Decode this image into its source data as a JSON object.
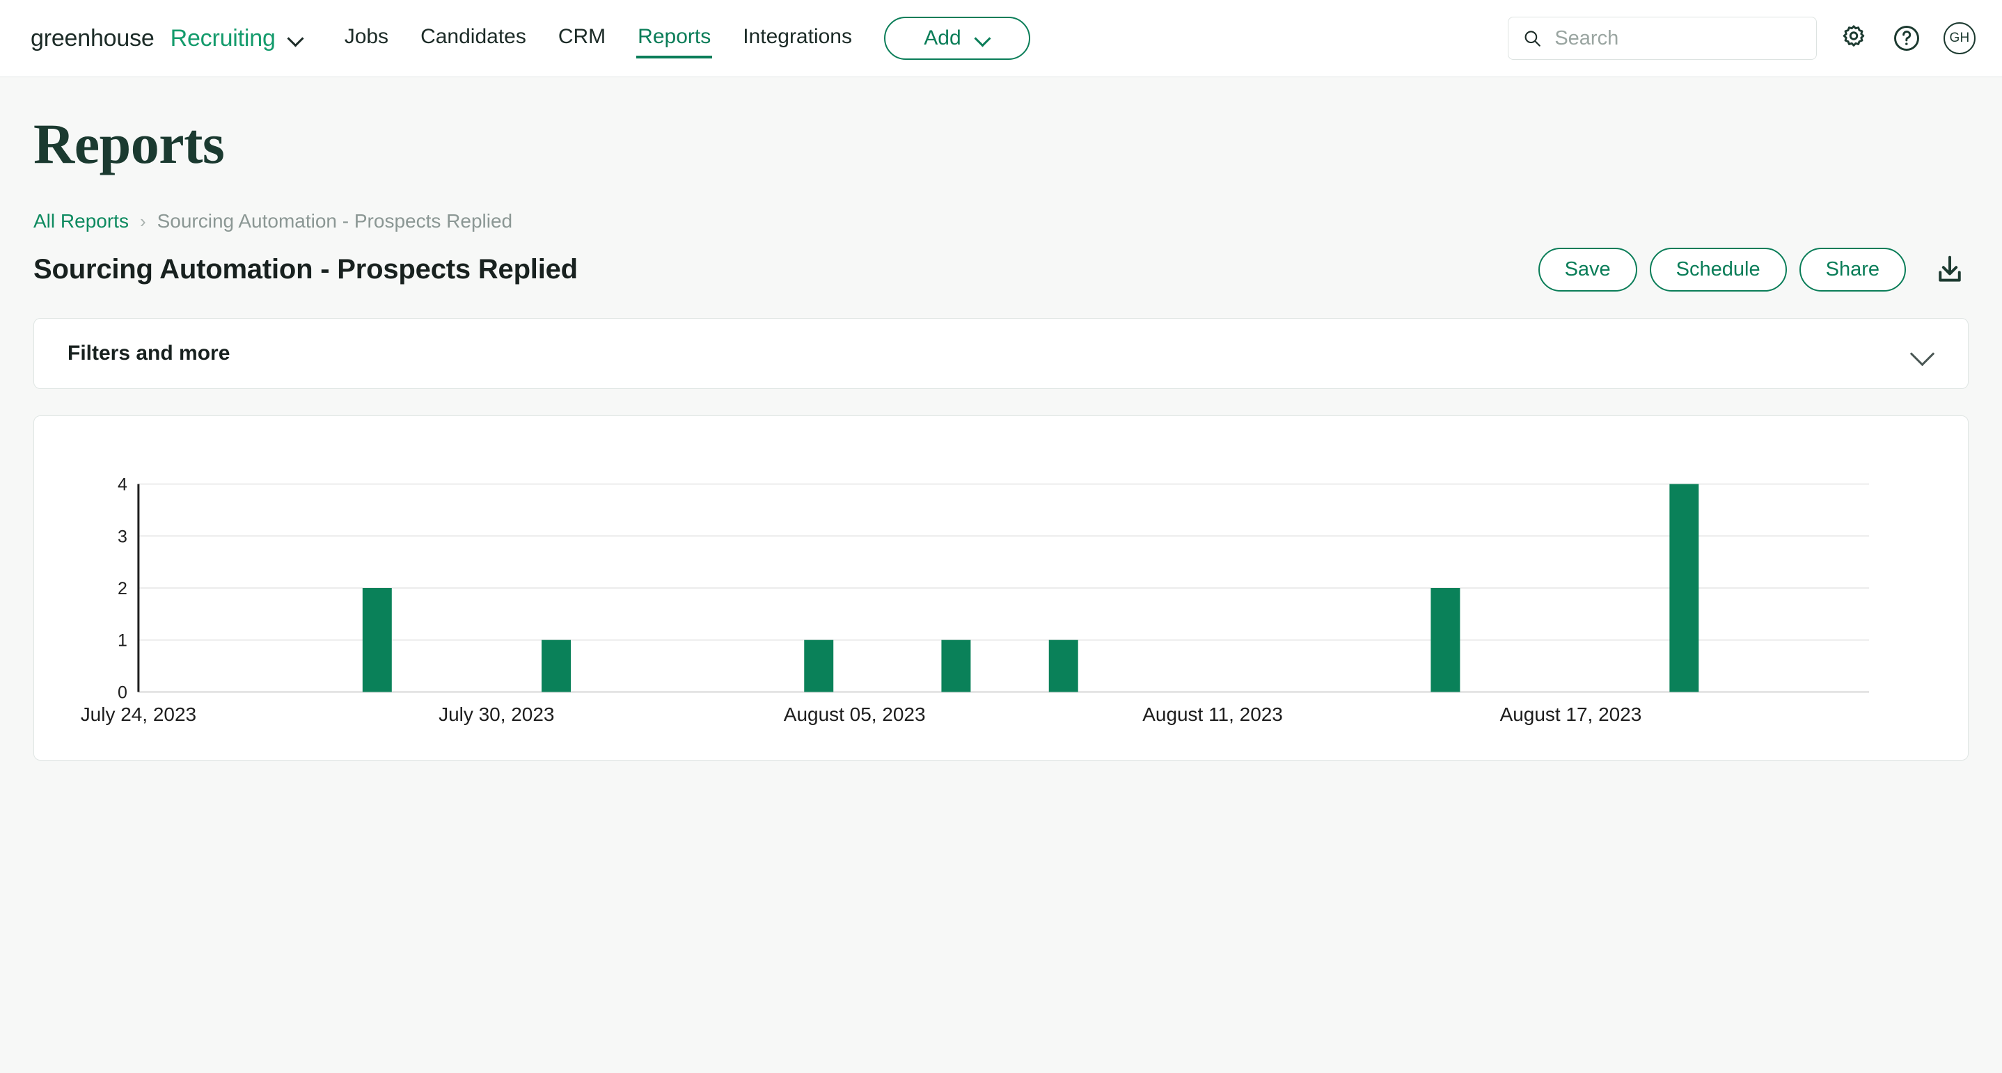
{
  "nav": {
    "brand_primary": "greenhouse",
    "brand_secondary": "Recruiting",
    "items": [
      {
        "label": "Jobs",
        "active": false
      },
      {
        "label": "Candidates",
        "active": false
      },
      {
        "label": "CRM",
        "active": false
      },
      {
        "label": "Reports",
        "active": true
      },
      {
        "label": "Integrations",
        "active": false
      }
    ],
    "add_label": "Add",
    "search_placeholder": "Search",
    "search_value": "",
    "avatar_initials": "GH"
  },
  "page": {
    "title": "Reports",
    "breadcrumb": {
      "root": "All Reports",
      "separator": "›",
      "current": "Sourcing Automation - Prospects Replied"
    },
    "report_title": "Sourcing Automation - Prospects Replied",
    "actions": {
      "save": "Save",
      "schedule": "Schedule",
      "share": "Share"
    },
    "filters_label": "Filters and more"
  },
  "colors": {
    "brand_green": "#0a7d58",
    "bar_green": "#0a8159",
    "accent_link": "#0d8a5f",
    "title_green": "#1b3a30"
  },
  "chart_data": {
    "type": "bar",
    "title": "",
    "xlabel": "",
    "ylabel": "",
    "ylim": [
      0,
      4
    ],
    "yticks": [
      "0",
      "1",
      "2",
      "3",
      "4"
    ],
    "grid": true,
    "legend": "none",
    "xticks": [
      "July 24, 2023",
      "July 30, 2023",
      "August 05, 2023",
      "August 11, 2023",
      "August 17, 2023"
    ],
    "xtick_positions": [
      0,
      6,
      12,
      18,
      24
    ],
    "x_domain_days": [
      0,
      29
    ],
    "categories": [
      "July 28, 2023",
      "July 31, 2023",
      "August 04, 2023",
      "August 06, 2023",
      "August 08, 2023",
      "August 14, 2023",
      "August 18, 2023"
    ],
    "day_offsets": [
      4.0,
      7.0,
      11.4,
      13.7,
      15.5,
      21.9,
      25.9
    ],
    "values": [
      2,
      1,
      1,
      1,
      1,
      2,
      4
    ]
  }
}
